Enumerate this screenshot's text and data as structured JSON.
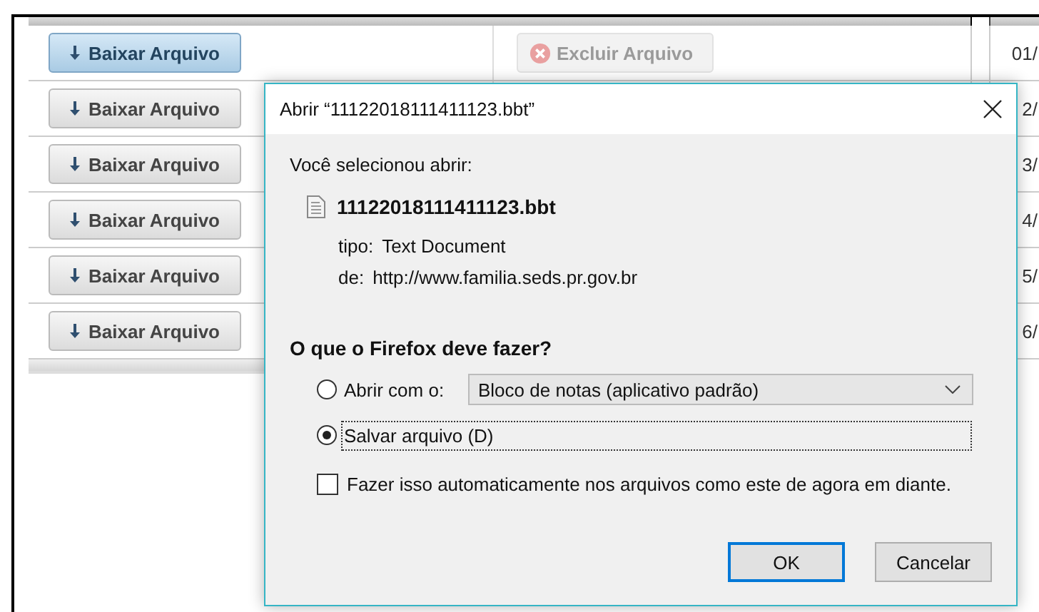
{
  "table": {
    "rows": [
      {
        "download": "Baixar Arquivo",
        "highlighted": true,
        "delete": {
          "label": "Excluir Arquivo",
          "disabled": true
        },
        "date": "01/"
      },
      {
        "download": "Baixar Arquivo",
        "highlighted": false,
        "date": "2/"
      },
      {
        "download": "Baixar Arquivo",
        "highlighted": false,
        "date": "3/"
      },
      {
        "download": "Baixar Arquivo",
        "highlighted": false,
        "date": "4/"
      },
      {
        "download": "Baixar Arquivo",
        "highlighted": false,
        "date": "5/"
      },
      {
        "download": "Baixar Arquivo",
        "highlighted": false,
        "date": "6/"
      }
    ]
  },
  "dialog": {
    "title": "Abrir “11122018111411123.bbt”",
    "intro": "Você selecionou abrir:",
    "file_name": "11122018111411123.bbt",
    "type_label": "tipo:",
    "type_value": "Text Document",
    "from_label": "de:",
    "from_value": "http://www.familia.seds.pr.gov.br",
    "question": "O que o Firefox deve fazer?",
    "options": [
      {
        "kind": "open_with",
        "label": "Abrir com o:",
        "selected": false,
        "focused": false,
        "app": "Bloco de notas (aplicativo padrão)"
      },
      {
        "kind": "save",
        "label": "Salvar arquivo (D)",
        "selected": true,
        "focused": true
      }
    ],
    "auto": {
      "label": "Fazer isso automaticamente nos arquivos como este de agora em diante.",
      "checked": false
    },
    "buttons": [
      {
        "label": "OK",
        "default": true
      },
      {
        "label": "Cancelar",
        "default": false
      }
    ]
  }
}
